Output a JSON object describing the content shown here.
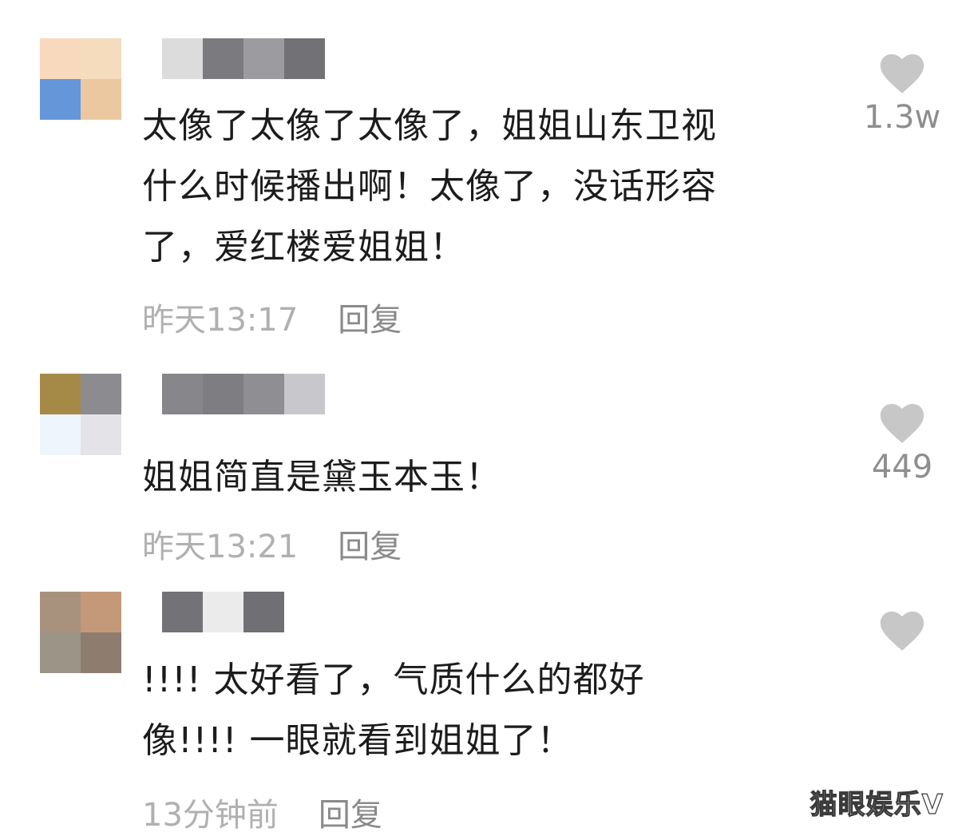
{
  "comments": [
    {
      "avatar_colors": [
        "#f9d9be",
        "#f4dcbd",
        "#6596d9",
        "#ecc8a0"
      ],
      "username_blocks": [
        "#dcdcdc",
        "#7a7a7f",
        "#9c9ca0",
        "#717176"
      ],
      "text_lines": [
        "太像了太像了太像了，姐姐山东卫视",
        "什么时候播出啊！太像了，没话形容",
        "了，爱红楼爱姐姐！"
      ],
      "time": "昨天13:17",
      "reply": "回复",
      "likes": "1.3w"
    },
    {
      "avatar_colors": [
        "#a58946",
        "#8c8b90",
        "#eef5fd",
        "#e4e4e8"
      ],
      "username_blocks": [
        "#86868b",
        "#7d7d82",
        "#8e8e93",
        "#c8c8cc"
      ],
      "text_lines": [
        "姐姐简直是黛玉本玉！"
      ],
      "time": "昨天13:21",
      "reply": "回复",
      "likes": "449"
    },
    {
      "avatar_colors": [
        "#a8917d",
        "#c4997a",
        "#9c9486",
        "#8e7c6e"
      ],
      "username_blocks": [
        "#727277",
        "#ebebeb",
        "#6f6f74"
      ],
      "text_lines": [
        "!!!! 太好看了，气质什么的都好",
        "像!!!! 一眼就看到姐姐了！"
      ],
      "time": "13分钟前",
      "reply": "回复",
      "likes": ""
    }
  ],
  "watermark": "猫眼娱乐V",
  "icons": {
    "like": "heart-icon"
  },
  "colors": {
    "heart": "#c7c7c7",
    "text": "#1c1c1c",
    "meta": "#b0b0b0"
  }
}
